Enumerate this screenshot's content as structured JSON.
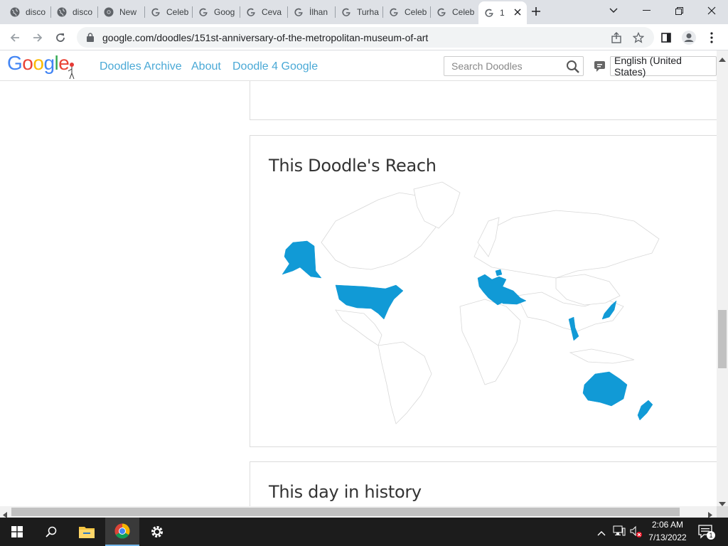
{
  "browser": {
    "tabs": [
      {
        "label": "disco",
        "icon": "globe-icon"
      },
      {
        "label": "disco",
        "icon": "globe-icon"
      },
      {
        "label": "New",
        "icon": "chrome-icon"
      },
      {
        "label": "Celeb",
        "icon": "google-g-icon"
      },
      {
        "label": "Goog",
        "icon": "google-g-icon"
      },
      {
        "label": "Ceva",
        "icon": "google-g-icon"
      },
      {
        "label": "İlhan",
        "icon": "google-g-icon"
      },
      {
        "label": "Turha",
        "icon": "google-g-icon"
      },
      {
        "label": "Celeb",
        "icon": "google-g-icon"
      },
      {
        "label": "Celeb",
        "icon": "google-g-icon"
      },
      {
        "label": "1",
        "icon": "google-g-icon",
        "active": true
      }
    ],
    "url": "google.com/doodles/151st-anniversary-of-the-metropolitan-museum-of-art"
  },
  "site": {
    "logo_letters": [
      "G",
      "o",
      "o",
      "g",
      "l",
      "e"
    ],
    "logo_colors": [
      "#4285f4",
      "#ea4335",
      "#fbbc05",
      "#4285f4",
      "#34a853",
      "#ea4335"
    ],
    "nav": {
      "archive": "Doodles Archive",
      "about": "About",
      "d4g": "Doodle 4 Google"
    },
    "search_placeholder": "Search Doodles",
    "language": "English (United States)",
    "link_color": "#4aa9d6"
  },
  "reach_card": {
    "title": "This Doodle's Reach",
    "highlight_color": "#119ad6",
    "highlighted_regions": [
      "United States",
      "Alaska",
      "Netherlands",
      "Germany",
      "Poland",
      "Czechia",
      "Hungary",
      "Romania",
      "Bulgaria",
      "Greece",
      "Turkey",
      "Italy",
      "Vietnam",
      "Japan",
      "South Korea",
      "Australia",
      "New Zealand"
    ]
  },
  "history_card": {
    "title": "This day in history"
  },
  "taskbar": {
    "time": "2:06 AM",
    "date": "7/13/2022",
    "notification_count": "1"
  }
}
